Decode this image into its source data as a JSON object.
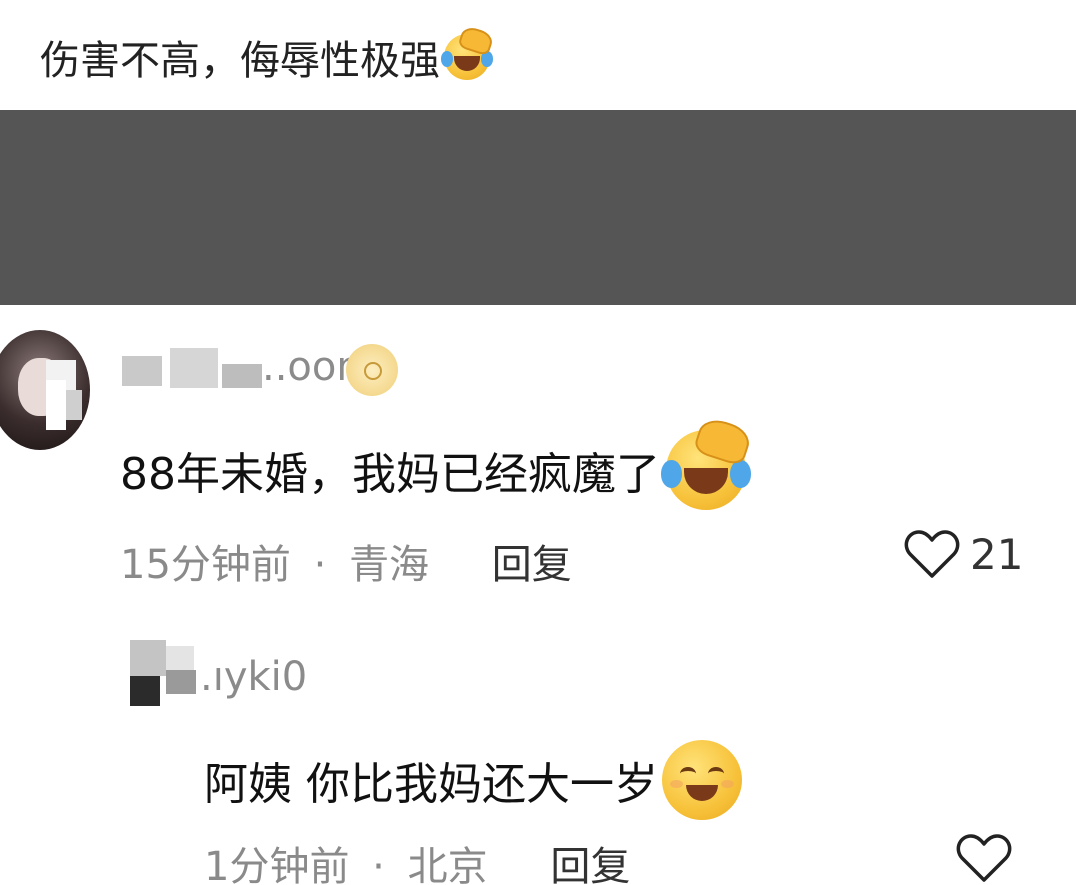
{
  "top_comment": {
    "text": "伤害不高，侮辱性极强",
    "emoji": "rolling-on-floor-laughing-emoji"
  },
  "comment1": {
    "username": "..oom",
    "text": "88年未婚，我妈已经疯魔了",
    "emoji": "rolling-on-floor-laughing-emoji",
    "time": "15分钟前",
    "separator": "·",
    "location": "青海",
    "reply_label": "回复",
    "likes": "21"
  },
  "reply1": {
    "username": ".ıyki0",
    "text": "阿姨 你比我妈还大一岁",
    "emoji": "smiling-face-emoji",
    "time": "1分钟前",
    "separator": "·",
    "location": "北京",
    "reply_label": "回复"
  },
  "colors": {
    "gray_block": "#545554",
    "meta_gray": "#8a8a8a",
    "text_dark": "#111111"
  }
}
